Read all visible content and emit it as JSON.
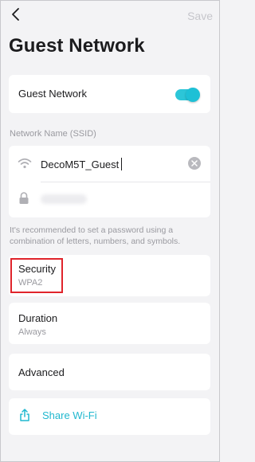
{
  "header": {
    "back_icon": "chevron-left-icon",
    "save_label": "Save",
    "title": "Guest Network"
  },
  "guest_toggle": {
    "label": "Guest Network",
    "enabled": true
  },
  "ssid_section": {
    "label": "Network Name (SSID)",
    "ssid_value": "DecoM5T_Guest",
    "wifi_icon": "wifi-icon",
    "clear_icon": "clear-icon",
    "lock_icon": "lock-icon",
    "hint": "It's recommended to set a password using a combination of letters, numbers, and symbols."
  },
  "security": {
    "label": "Security",
    "value": "WPA2"
  },
  "duration": {
    "label": "Duration",
    "value": "Always"
  },
  "advanced": {
    "label": "Advanced"
  },
  "share": {
    "label": "Share Wi-Fi",
    "icon": "share-icon"
  },
  "colors": {
    "accent": "#21b8cf",
    "toggle_on": "#2cc6d8",
    "highlight": "#e0242b",
    "background": "#f3f3f5"
  }
}
